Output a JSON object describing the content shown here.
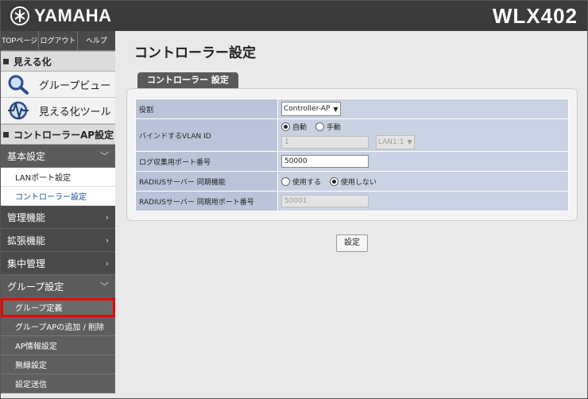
{
  "brand": {
    "logo_text": "YAMAHA",
    "model": "WLX402"
  },
  "topnav": [
    "TOPページ",
    "ログアウト",
    "ヘルプ"
  ],
  "sidebar": {
    "visualize_header": "見える化",
    "tools": [
      {
        "label": "グループビュー",
        "icon": "magnifier-icon"
      },
      {
        "label": "見える化ツール",
        "icon": "pulse-globe-icon"
      }
    ],
    "controller_header": "コントローラーAP設定",
    "basic": {
      "label": "基本設定",
      "items": [
        "LANポート設定",
        "コントローラー設定"
      ]
    },
    "sections": [
      "管理機能",
      "拡張機能",
      "集中管理"
    ],
    "group": {
      "label": "グループ設定",
      "items": [
        "グループ定義",
        "グループAPの追加 / 削除",
        "AP情報設定",
        "無線設定",
        "設定送信"
      ]
    }
  },
  "main": {
    "title": "コントローラー設定",
    "tab": "コントローラー 設定",
    "rows": {
      "role": {
        "label": "役割",
        "value": "Controller-AP"
      },
      "vlan": {
        "label": "バインドするVLAN ID",
        "opt_auto": "自動",
        "opt_manual": "手動",
        "id_value": "1",
        "port_value": "LAN1:1"
      },
      "log_port": {
        "label": "ログ収集用ポート番号",
        "value": "50000"
      },
      "radius": {
        "label": "RADIUSサーバー 同期機能",
        "opt_use": "使用する",
        "opt_nouse": "使用しない"
      },
      "radius_port": {
        "label": "RADIUSサーバー 同期用ポート番号",
        "value": "50001"
      }
    },
    "submit": "設定"
  }
}
